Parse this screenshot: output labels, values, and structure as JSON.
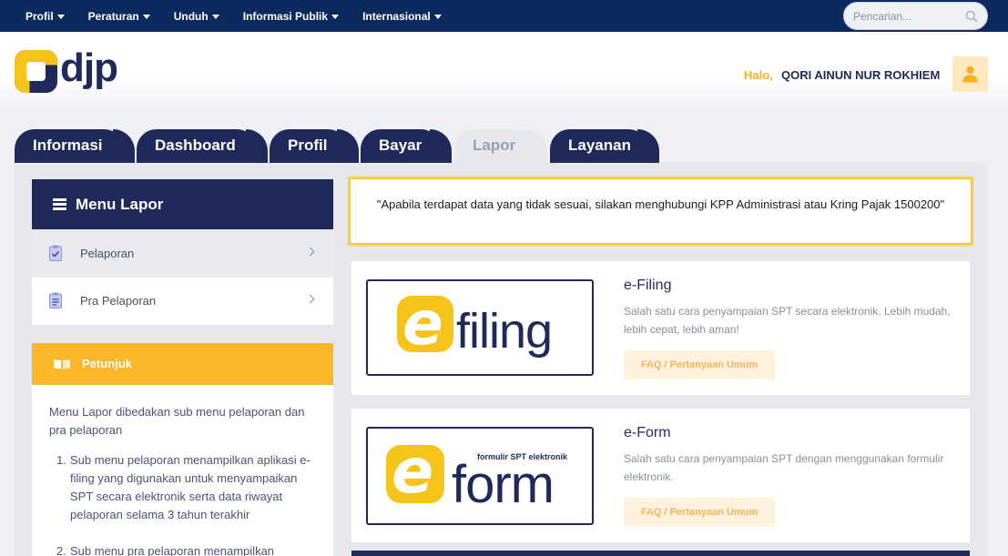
{
  "nav": {
    "items": [
      {
        "label": "Profil"
      },
      {
        "label": "Peraturan"
      },
      {
        "label": "Unduh"
      },
      {
        "label": "Informasi Publik"
      },
      {
        "label": "Internasional"
      }
    ],
    "search_placeholder": "Pencarian..."
  },
  "header": {
    "logo_text": "djp",
    "greeting": "Halo,",
    "user_name": "QORI AINUN NUR ROKHIEM",
    "icons": {
      "avatar": "user-icon"
    }
  },
  "tabs": [
    {
      "label": "Informasi"
    },
    {
      "label": "Dashboard"
    },
    {
      "label": "Profil"
    },
    {
      "label": "Bayar"
    },
    {
      "label": "Lapor",
      "active": true
    },
    {
      "label": "Layanan"
    }
  ],
  "sidebar": {
    "title": "Menu Lapor",
    "items": [
      {
        "label": "Pelaporan",
        "icon": "clipboard-check-icon"
      },
      {
        "label": "Pra Pelaporan",
        "icon": "clipboard-list-icon"
      }
    ]
  },
  "petunjuk": {
    "title": "Petunjuk",
    "intro": "Menu Lapor dibedakan sub menu pelaporan dan pra pelaporan",
    "list": [
      {
        "num": "1.",
        "text": "Sub menu pelaporan menampilkan aplikasi e-filing yang digunakan untuk menyampaikan SPT secara elektronik serta data riwayat pelaporan selama 3 tahun terakhir"
      },
      {
        "num": "2.",
        "text": "Sub menu pra pelaporan menampilkan"
      }
    ]
  },
  "notice": {
    "text": "\"Apabila terdapat data yang tidak sesuai, silakan menghubungi KPP Administrasi atau Kring Pajak 1500200\""
  },
  "cards": [
    {
      "logo_letter": "e",
      "logo_word": "filing",
      "title": "e-Filing",
      "description": "Salah satu cara penyampaian SPT secara elektronik. Lebih mudah, lebih cepat, lebih aman!",
      "faq_label": "FAQ / Pertanyaan Umum"
    },
    {
      "logo_letter": "e",
      "logo_word": "form",
      "logo_tagline": "formulir SPT elektronik",
      "title": "e-Form",
      "description": "Salah satu cara penyampaian SPT dengan menggunakan formulir elektronik.",
      "faq_label": "FAQ / Pertanyaan Umum"
    }
  ],
  "colors": {
    "navy": "#1f2a5a",
    "top_nav": "#0c2a5e",
    "accent_yellow": "#f6c31b",
    "petunjuk_orange": "#fbb72a",
    "greeting": "#f5b11d"
  }
}
